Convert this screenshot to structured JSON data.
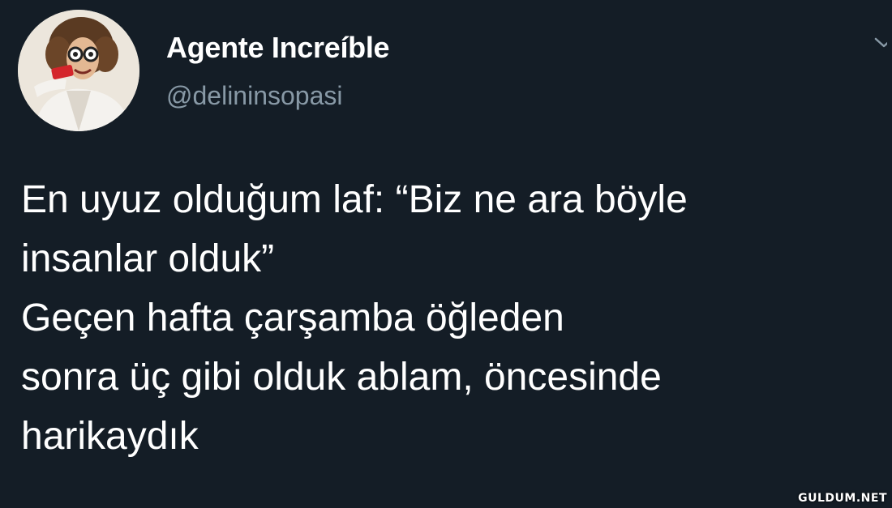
{
  "author": {
    "name": "Agente Increíble",
    "handle": "@delininsopasi"
  },
  "tweet": {
    "lines": [
      "En uyuz olduğum laf: “Biz ne ara böyle",
      "insanlar olduk”",
      "Geçen hafta çarşamba öğleden",
      "sonra üç gibi olduk ablam, öncesinde",
      "harikaydık"
    ]
  },
  "watermark": "GULDUM.NET",
  "icons": {
    "menu": "chevron-down-icon"
  },
  "colors": {
    "background": "#141d26",
    "text": "#ffffff",
    "secondary_text": "#8899a6"
  }
}
